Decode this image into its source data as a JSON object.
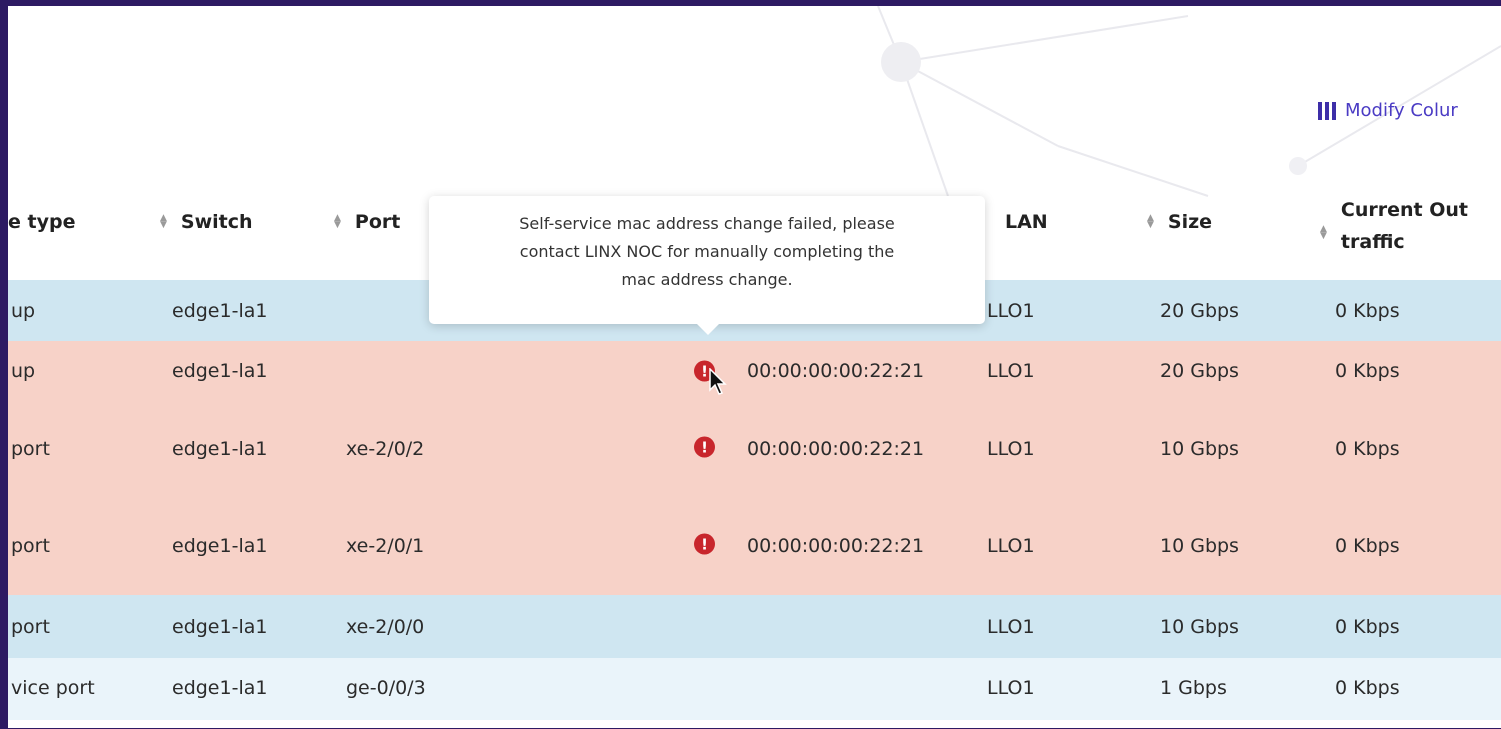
{
  "toolbar": {
    "modify_columns_label": "Modify Colur"
  },
  "columns": [
    {
      "id": "type",
      "label": "e type",
      "sortable": false
    },
    {
      "id": "switch",
      "label": "Switch",
      "sortable": true
    },
    {
      "id": "port",
      "label": "Port",
      "sortable": true
    },
    {
      "id": "lan",
      "label": "LAN",
      "sortable": false
    },
    {
      "id": "size",
      "label": "Size",
      "sortable": true
    },
    {
      "id": "traffic",
      "label_line1": "Current Out",
      "label_line2": "traffic",
      "sortable": true
    }
  ],
  "tooltip": {
    "line1": "Self-service mac address change failed, please",
    "line2": "contact LINX NOC for manually completing the",
    "line3": "mac address change."
  },
  "rows": [
    {
      "type": "up",
      "switch": "edge1-la1",
      "port": "",
      "error": false,
      "mac": "",
      "lan": "LLO1",
      "size": "20 Gbps",
      "traffic": "0 Kbps",
      "status": "blue"
    },
    {
      "type": "up",
      "switch": "edge1-la1",
      "port": "",
      "error": true,
      "mac": "00:00:00:00:22:21",
      "lan": "LLO1",
      "size": "20 Gbps",
      "traffic": "0 Kbps",
      "status": "red"
    },
    {
      "type": "port",
      "switch": "edge1-la1",
      "port": "xe-2/0/2",
      "error": true,
      "mac": "00:00:00:00:22:21",
      "lan": "LLO1",
      "size": "10 Gbps",
      "traffic": "0 Kbps",
      "status": "red"
    },
    {
      "type": "port",
      "switch": "edge1-la1",
      "port": "xe-2/0/1",
      "error": true,
      "mac": "00:00:00:00:22:21",
      "lan": "LLO1",
      "size": "10 Gbps",
      "traffic": "0 Kbps",
      "status": "red"
    },
    {
      "type": "port",
      "switch": "edge1-la1",
      "port": "xe-2/0/0",
      "error": false,
      "mac": "",
      "lan": "LLO1",
      "size": "10 Gbps",
      "traffic": "0 Kbps",
      "status": "blue"
    },
    {
      "type": "vice port",
      "switch": "edge1-la1",
      "port": "ge-0/0/3",
      "error": false,
      "mac": "",
      "lan": "LLO1",
      "size": "1 Gbps",
      "traffic": "0 Kbps",
      "status": "pale"
    }
  ],
  "error_icon": "exclamation-circle-icon",
  "colors": {
    "frame": "#2d1a63",
    "row_blue": "#cfe6f1",
    "row_red": "#f7d2c8",
    "row_pale": "#eaf4fa",
    "error": "#c8262c",
    "accent": "#4a3bc4"
  }
}
